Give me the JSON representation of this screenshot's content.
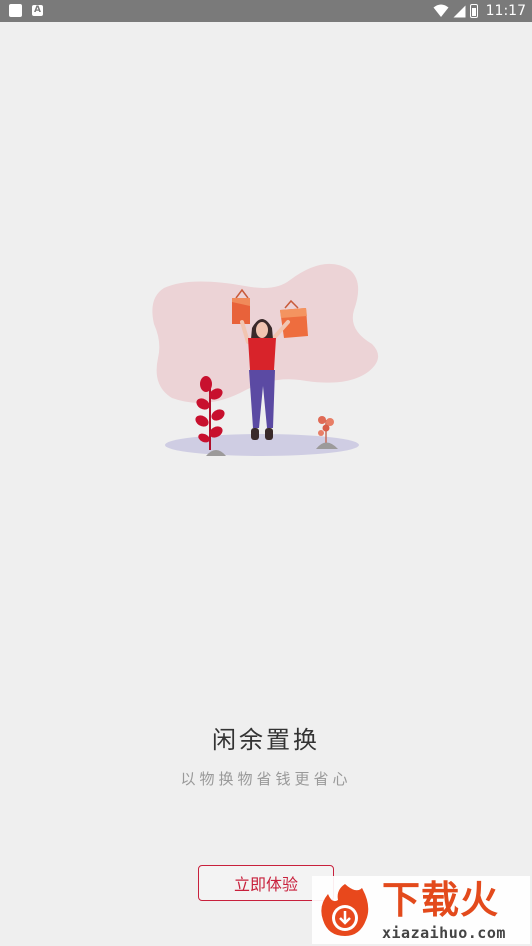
{
  "status_bar": {
    "time": "11:17",
    "battery_level_text": "1",
    "icons": [
      "notification-square-icon",
      "a-letter-icon",
      "wifi-icon",
      "signal-icon",
      "battery-icon"
    ]
  },
  "onboarding": {
    "title": "闲余置换",
    "subtitle": "以物换物省钱更省心",
    "cta_label": "立即体验"
  },
  "watermark": {
    "brand": "下载火",
    "url": "xiazaihuo.com"
  },
  "colors": {
    "background": "#efefef",
    "accent": "#c8203c",
    "blob": "#ecd3d6",
    "ground": "#cfcde3"
  }
}
